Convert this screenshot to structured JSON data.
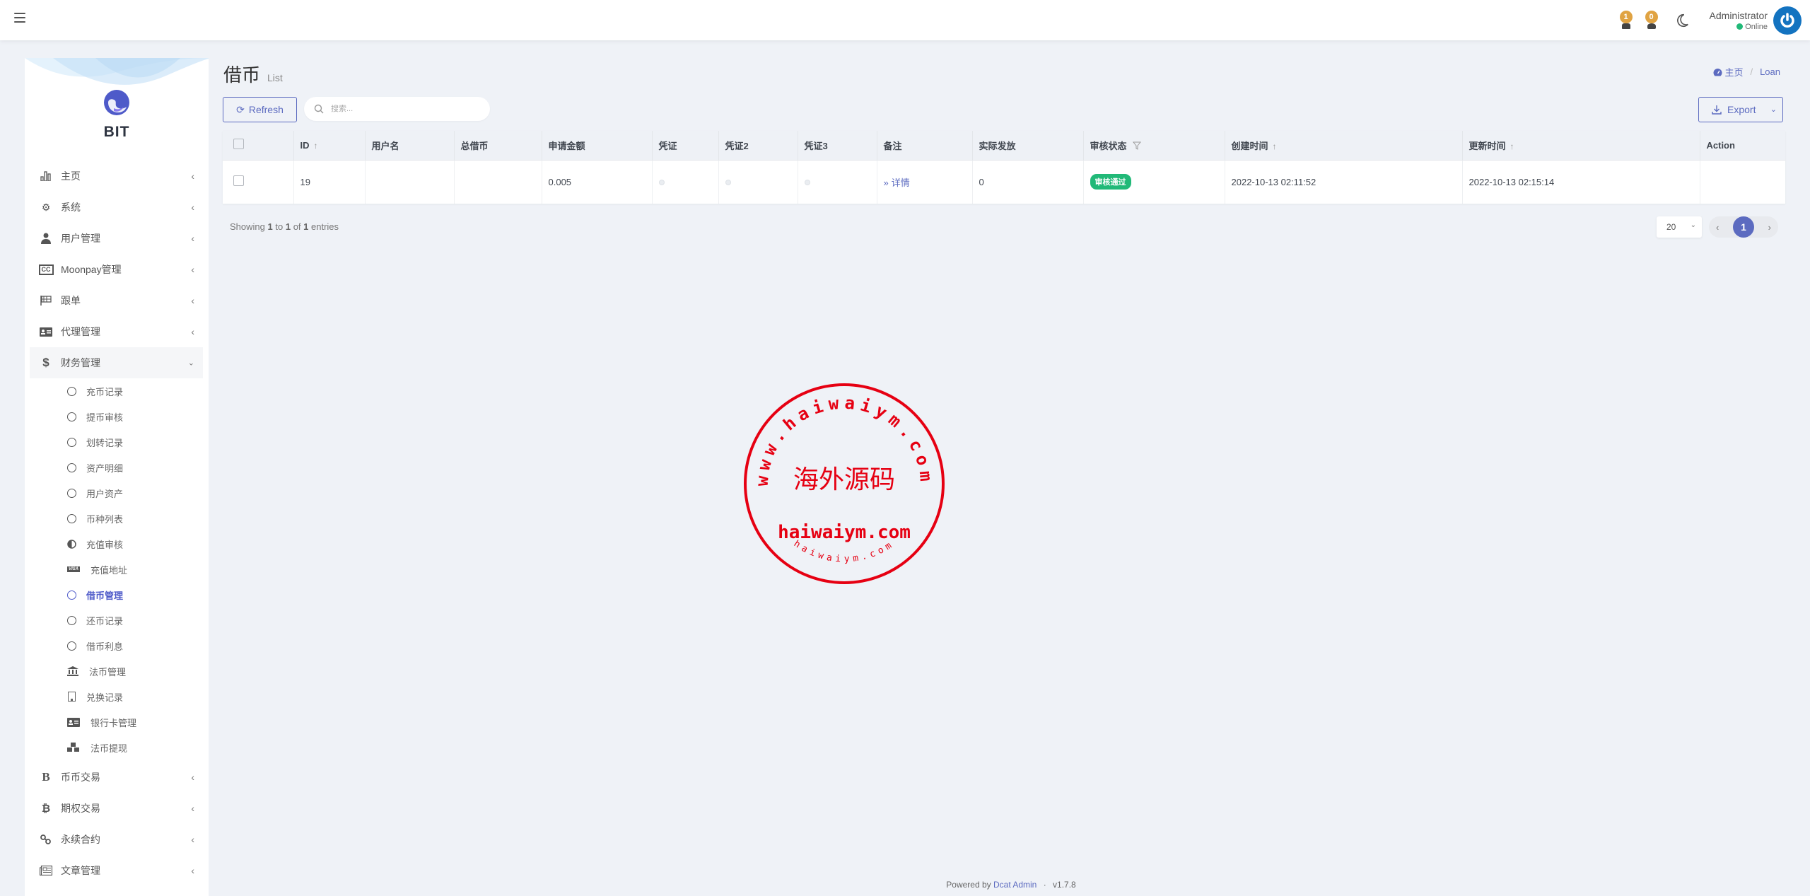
{
  "navbar": {
    "notifications": [
      {
        "icon": "bell-icon",
        "count": "1"
      },
      {
        "icon": "user-alert-icon",
        "count": "0"
      }
    ],
    "theme_icon": "moon-icon",
    "user": {
      "name": "Administrator",
      "status": "Online",
      "status_color": "#21b978",
      "avatar_color": "#1373c0"
    }
  },
  "sidebar": {
    "logo_text": "BIT",
    "menu": [
      {
        "label": "主页",
        "icon": "bar-chart-icon",
        "expanded": false
      },
      {
        "label": "系统",
        "icon": "gear-icon",
        "expanded": false
      },
      {
        "label": "用户管理",
        "icon": "user-tie-icon",
        "expanded": false
      },
      {
        "label": "Moonpay管理",
        "icon": "cc-icon",
        "expanded": false
      },
      {
        "label": "跟单",
        "icon": "flag-checkered-icon",
        "expanded": false
      },
      {
        "label": "代理管理",
        "icon": "id-card-icon",
        "expanded": false
      },
      {
        "label": "财务管理",
        "icon": "dollar-icon",
        "expanded": true,
        "children": [
          {
            "label": "充币记录",
            "icon": "circle-icon"
          },
          {
            "label": "提币审核",
            "icon": "circle-icon"
          },
          {
            "label": "划转记录",
            "icon": "circle-icon"
          },
          {
            "label": "资产明细",
            "icon": "circle-icon"
          },
          {
            "label": "用户资产",
            "icon": "circle-icon"
          },
          {
            "label": "币种列表",
            "icon": "circle-icon"
          },
          {
            "label": "充值审核",
            "icon": "half-circle-icon"
          },
          {
            "label": "充值地址",
            "icon": "visa-icon"
          },
          {
            "label": "借币管理",
            "icon": "circle-icon",
            "active": true
          },
          {
            "label": "还币记录",
            "icon": "circle-icon"
          },
          {
            "label": "借币利息",
            "icon": "circle-icon"
          },
          {
            "label": "法币管理",
            "icon": "bank-icon"
          },
          {
            "label": "兑换记录",
            "icon": "building-icon"
          },
          {
            "label": "银行卡管理",
            "icon": "id-card-icon"
          },
          {
            "label": "法币提现",
            "icon": "cubes-icon"
          }
        ]
      },
      {
        "label": "币币交易",
        "icon": "bold-b-icon",
        "expanded": false
      },
      {
        "label": "期权交易",
        "icon": "bitcoin-icon",
        "expanded": false
      },
      {
        "label": "永续合约",
        "icon": "link-icon",
        "expanded": false
      },
      {
        "label": "文章管理",
        "icon": "newspaper-icon",
        "expanded": false
      }
    ]
  },
  "page": {
    "title": "借币",
    "subtitle": "List",
    "breadcrumb": [
      {
        "label": "主页",
        "icon": "dashboard-icon"
      },
      {
        "label": "Loan"
      }
    ],
    "refresh_label": "Refresh",
    "search_placeholder": "搜索...",
    "export_label": "Export"
  },
  "table": {
    "columns": [
      {
        "key": "checkbox",
        "label": ""
      },
      {
        "key": "id",
        "label": "ID",
        "sortable": true
      },
      {
        "key": "username",
        "label": "用户名"
      },
      {
        "key": "total_borrow",
        "label": "总借币"
      },
      {
        "key": "amount",
        "label": "申请金额"
      },
      {
        "key": "proof1",
        "label": "凭证"
      },
      {
        "key": "proof2",
        "label": "凭证2"
      },
      {
        "key": "proof3",
        "label": "凭证3"
      },
      {
        "key": "remark",
        "label": "备注"
      },
      {
        "key": "issued",
        "label": "实际发放"
      },
      {
        "key": "status",
        "label": "审核状态",
        "filterable": true
      },
      {
        "key": "created_at",
        "label": "创建时间",
        "sortable": true
      },
      {
        "key": "updated_at",
        "label": "更新时间",
        "sortable": true
      },
      {
        "key": "action",
        "label": "Action"
      }
    ],
    "rows": [
      {
        "id": "19",
        "username": "",
        "total_borrow": "",
        "amount": "0.005",
        "remark": "详情",
        "issued": "0",
        "status": "审核通过",
        "status_color": "#21b978",
        "created_at": "2022-10-13 02:11:52",
        "updated_at": "2022-10-13 02:15:14",
        "action": ""
      }
    ]
  },
  "pagination": {
    "showing_prefix": "Showing",
    "from": "1",
    "to_word": "to",
    "to": "1",
    "of_word": "of",
    "total": "1",
    "entries_word": "entries",
    "per_page": "20",
    "current_page": "1"
  },
  "watermark": {
    "center_text": "海外源码",
    "line_text": "haiwaiym.com",
    "top_arc": "www.haiwaiym.com",
    "bottom_arc": "haiwaiym.com",
    "color": "#e60012"
  },
  "footer": {
    "prefix": "Powered by",
    "brand": "Dcat Admin",
    "separator": "·",
    "version": "v1.7.8"
  },
  "colors": {
    "primary": "#5c6bc0",
    "success": "#21b978",
    "badge": "#e0a342"
  }
}
